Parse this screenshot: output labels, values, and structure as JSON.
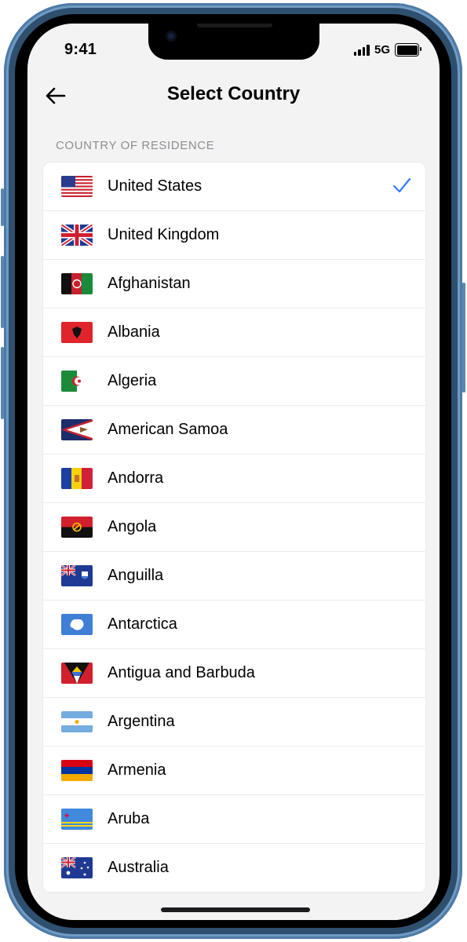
{
  "status_bar": {
    "time": "9:41",
    "network": "5G"
  },
  "header": {
    "title": "Select Country",
    "back_icon": "arrow-left-icon"
  },
  "section": {
    "label": "COUNTRY OF RESIDENCE"
  },
  "accent_color": "#3478f6",
  "countries": [
    {
      "name": "United States",
      "flag": "us",
      "selected": true
    },
    {
      "name": "United Kingdom",
      "flag": "gb",
      "selected": false
    },
    {
      "name": "Afghanistan",
      "flag": "af",
      "selected": false
    },
    {
      "name": "Albania",
      "flag": "al",
      "selected": false
    },
    {
      "name": "Algeria",
      "flag": "dz",
      "selected": false
    },
    {
      "name": "American Samoa",
      "flag": "as",
      "selected": false
    },
    {
      "name": "Andorra",
      "flag": "ad",
      "selected": false
    },
    {
      "name": "Angola",
      "flag": "ao",
      "selected": false
    },
    {
      "name": "Anguilla",
      "flag": "ai",
      "selected": false
    },
    {
      "name": "Antarctica",
      "flag": "aq",
      "selected": false
    },
    {
      "name": "Antigua and Barbuda",
      "flag": "ag",
      "selected": false
    },
    {
      "name": "Argentina",
      "flag": "ar",
      "selected": false
    },
    {
      "name": "Armenia",
      "flag": "am",
      "selected": false
    },
    {
      "name": "Aruba",
      "flag": "aw",
      "selected": false
    },
    {
      "name": "Australia",
      "flag": "au",
      "selected": false
    }
  ]
}
